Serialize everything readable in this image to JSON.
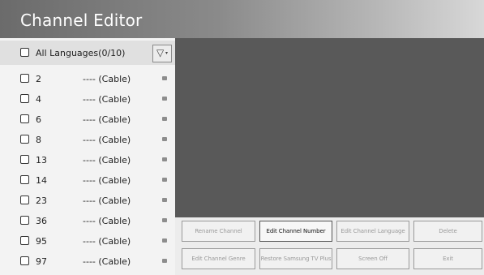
{
  "header": {
    "title": "Channel Editor"
  },
  "language_filter": {
    "label": "All Languages(0/10)",
    "filter_glyph": "▽",
    "filter_caret": "▾",
    "filter_icon": "filter-icon"
  },
  "channels": [
    {
      "number": "2",
      "name": "---- (Cable)"
    },
    {
      "number": "4",
      "name": "---- (Cable)"
    },
    {
      "number": "6",
      "name": "---- (Cable)"
    },
    {
      "number": "8",
      "name": "---- (Cable)"
    },
    {
      "number": "13",
      "name": "---- (Cable)"
    },
    {
      "number": "14",
      "name": "---- (Cable)"
    },
    {
      "number": "23",
      "name": "---- (Cable)"
    },
    {
      "number": "36",
      "name": "---- (Cable)"
    },
    {
      "number": "95",
      "name": "---- (Cable)"
    },
    {
      "number": "97",
      "name": "---- (Cable)"
    }
  ],
  "actions": {
    "rename_channel": "Rename Channel",
    "edit_channel_number": "Edit Channel Number",
    "edit_channel_language": "Edit Channel Language",
    "delete": "Delete",
    "edit_channel_genre": "Edit Channel Genre",
    "restore_samsung_tv_plus": "Restore Samsung TV Plus",
    "screen_off": "Screen Off",
    "exit": "Exit"
  },
  "colors": {
    "preview_background": "#595959",
    "focused_button_text": "#111111",
    "disabled_button_text": "#9a9a9a"
  }
}
